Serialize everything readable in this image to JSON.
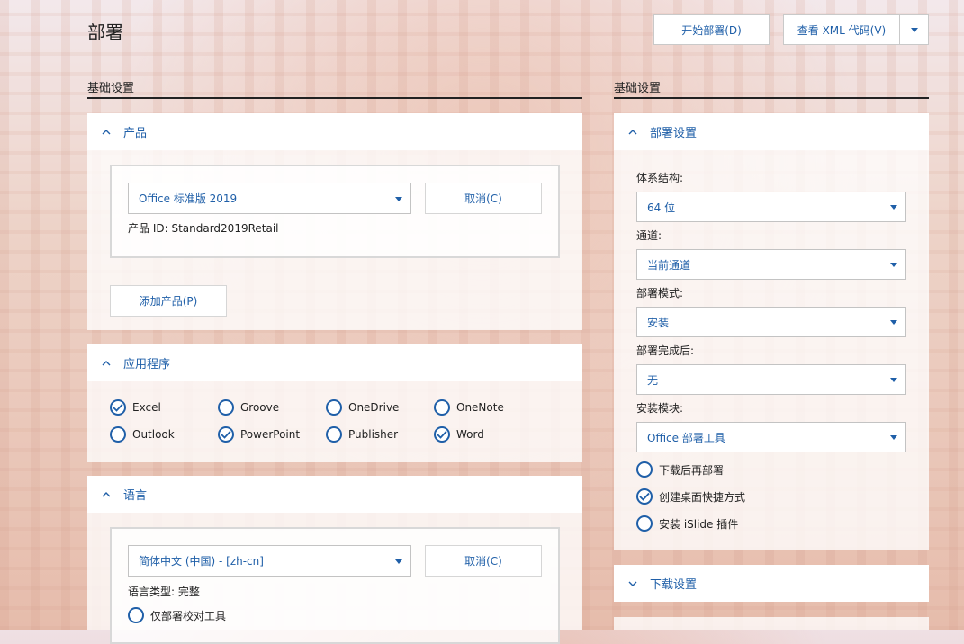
{
  "page_title": "部署",
  "toolbar": {
    "start_deploy": "开始部署(D)",
    "view_xml": "查看 XML 代码(V)"
  },
  "left": {
    "section_label": "基础设置",
    "products_panel": {
      "title": "产品",
      "product_select": "Office 标准版 2019",
      "cancel": "取消(C)",
      "product_id": "产品 ID: Standard2019Retail",
      "add_product": "添加产品(P)"
    },
    "apps_panel": {
      "title": "应用程序",
      "apps": [
        {
          "label": "Excel",
          "checked": true
        },
        {
          "label": "Groove",
          "checked": false
        },
        {
          "label": "OneDrive",
          "checked": false
        },
        {
          "label": "OneNote",
          "checked": false
        },
        {
          "label": "Outlook",
          "checked": false
        },
        {
          "label": "PowerPoint",
          "checked": true
        },
        {
          "label": "Publisher",
          "checked": false
        },
        {
          "label": "Word",
          "checked": true
        }
      ]
    },
    "language_panel": {
      "title": "语言",
      "language_select": "简体中文 (中国) - [zh-cn]",
      "cancel": "取消(C)",
      "language_type": "语言类型: 完整",
      "proofing_only": "仅部署校对工具",
      "proofing_only_checked": false
    }
  },
  "right": {
    "section_label": "基础设置",
    "deploy_panel": {
      "title": "部署设置",
      "fields": [
        {
          "label": "体系结构:",
          "value": "64 位"
        },
        {
          "label": "通道:",
          "value": "当前通道"
        },
        {
          "label": "部署模式:",
          "value": "安装"
        },
        {
          "label": "部署完成后:",
          "value": "无"
        },
        {
          "label": "安装模块:",
          "value": "Office 部署工具"
        }
      ],
      "options": [
        {
          "label": "下载后再部署",
          "checked": false
        },
        {
          "label": "创建桌面快捷方式",
          "checked": true
        },
        {
          "label": "安装 iSlide 插件",
          "checked": false
        }
      ]
    },
    "download_panel": {
      "title": "下载设置"
    }
  },
  "colors": {
    "accent": "#1f5fa8",
    "text": "#222222"
  }
}
